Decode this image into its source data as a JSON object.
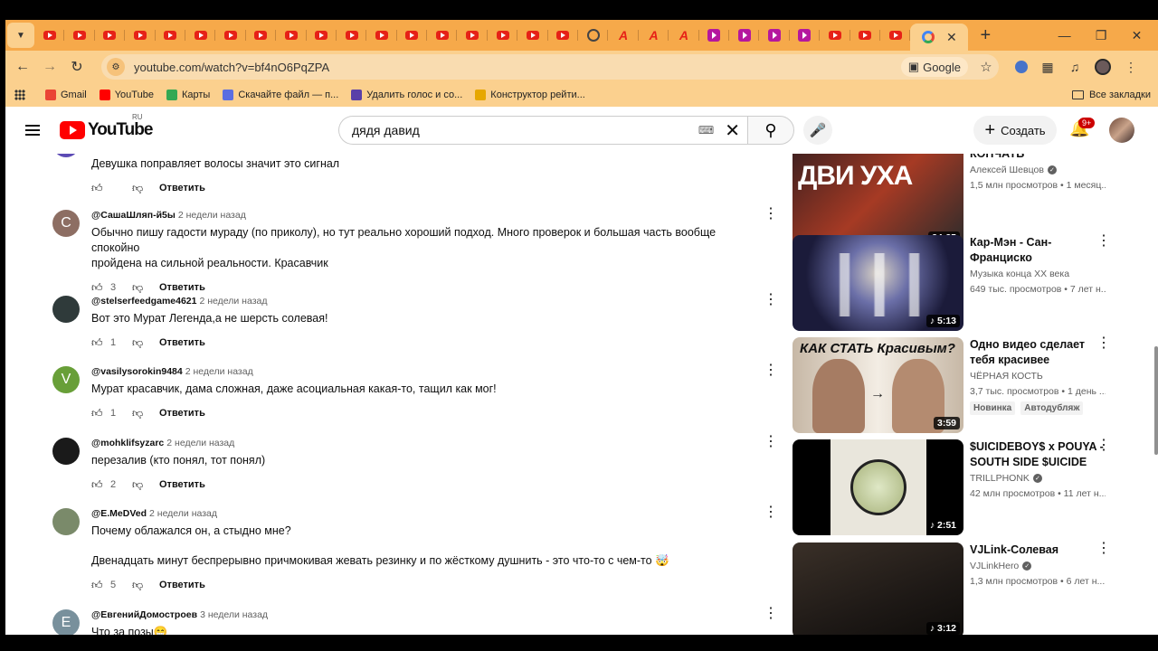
{
  "browser": {
    "url": "youtube.com/watch?v=bf4nO6PqZPA",
    "search_engine_chip": "Google",
    "bookmarks": [
      {
        "label": "Gmail",
        "color": "#ea4335"
      },
      {
        "label": "YouTube",
        "color": "#ff0000"
      },
      {
        "label": "Карты",
        "color": "#34a853"
      },
      {
        "label": "Скачайте файл — п...",
        "color": "#5b6ee1"
      },
      {
        "label": "Удалить голос и со...",
        "color": "#5a3fa8"
      },
      {
        "label": "Конструктор рейти...",
        "color": "#e6a700"
      }
    ],
    "all_bookmarks": "Все закладки"
  },
  "youtube": {
    "logo": "YouTube",
    "country": "RU",
    "search_query": "дядя давид",
    "create_label": "Создать",
    "notifications": "9+"
  },
  "comments": [
    {
      "author": "",
      "time": "",
      "avatar_letter": "A",
      "avatar_color": "#5c4bb5",
      "text": [
        "Девушка поправляет волосы значит это сигнал"
      ],
      "likes": "",
      "reply": "Ответить"
    },
    {
      "author": "@СашаШляп-й5ы",
      "time": "2 недели назад",
      "avatar_letter": "C",
      "avatar_color": "#8d6e63",
      "text": [
        "Обычно пишу гадости мураду (по приколу), но тут реально хороший подход. Много проверок и большая часть вообще спокойно",
        "пройдена на сильной реальности. Красавчик"
      ],
      "likes": "3",
      "reply": "Ответить"
    },
    {
      "author": "@stelserfeedgame4621",
      "time": "2 недели назад",
      "avatar_letter": "",
      "avatar_color": "#2f3a3a",
      "text": [
        "Вот это Мурат Легенда,а не шерсть солевая!"
      ],
      "likes": "1",
      "reply": "Ответить"
    },
    {
      "author": "@vasilysorokin9484",
      "time": "2 недели назад",
      "avatar_letter": "V",
      "avatar_color": "#689f38",
      "text": [
        "Мурат красавчик, дама сложная, даже асоциальная какая-то, тащил как мог!"
      ],
      "likes": "1",
      "reply": "Ответить"
    },
    {
      "author": "@mohklifsyzarc",
      "time": "2 недели назад",
      "avatar_letter": "",
      "avatar_color": "#1a1a1a",
      "text": [
        "перезалив (кто понял, тот понял)"
      ],
      "likes": "2",
      "reply": "Ответить"
    },
    {
      "author": "@E.MeDVed",
      "time": "2 недели назад",
      "avatar_letter": "",
      "avatar_color": "#7a8a6a",
      "text": [
        "Почему облажался он, а стыдно мне?",
        "",
        "Двенадцать минут беспрерывно причмокивая жевать резинку и по жёсткому душнить  - это что-то с чем-то 🤯"
      ],
      "likes": "5",
      "reply": "Ответить"
    },
    {
      "author": "@ЕвгенийДомостроев",
      "time": "3 недели назад",
      "avatar_letter": "E",
      "avatar_color": "#78909c",
      "text": [
        "Что за позы😁"
      ],
      "likes": "",
      "reply": "Ответить"
    }
  ],
  "recommendations": [
    {
      "title": [
        "КОНЧАТЬ"
      ],
      "channel": "Алексей Шевцов",
      "verified": true,
      "meta": "1,5 млн просмотров • 1 месяц...",
      "duration": "24:35",
      "music": false,
      "thumb_text": "ДВИ  УХА",
      "badges": []
    },
    {
      "title": [
        "Кар-Мэн - Сан-",
        "Франциско"
      ],
      "channel": "Музыка конца XX века",
      "verified": false,
      "meta": "649 тыс. просмотров • 7 лет н...",
      "duration": "5:13",
      "music": true,
      "thumb_text": "",
      "badges": []
    },
    {
      "title": [
        "Одно видео сделает",
        "тебя красивее"
      ],
      "channel": "ЧЁРНАЯ КОСТЬ",
      "verified": false,
      "meta": "3,7 тыс. просмотров • 1 день ...",
      "duration": "3:59",
      "music": false,
      "thumb_text": "КАК СТАТЬ Красивым?",
      "badges": [
        "Новинка",
        "Автодубляж"
      ]
    },
    {
      "title": [
        "$UICIDEBOY$ x POUYA -",
        "SOUTH SIDE $UICIDE"
      ],
      "channel": "TRILLPHONK",
      "verified": true,
      "meta": "42 млн просмотров • 11 лет н...",
      "duration": "2:51",
      "music": true,
      "thumb_text": "",
      "badges": []
    },
    {
      "title": [
        "VJLink-Солевая"
      ],
      "channel": "VJLinkHero",
      "verified": true,
      "meta": "1,3 млн просмотров • 6 лет н...",
      "duration": "3:12",
      "music": true,
      "thumb_text": "",
      "badges": []
    }
  ]
}
